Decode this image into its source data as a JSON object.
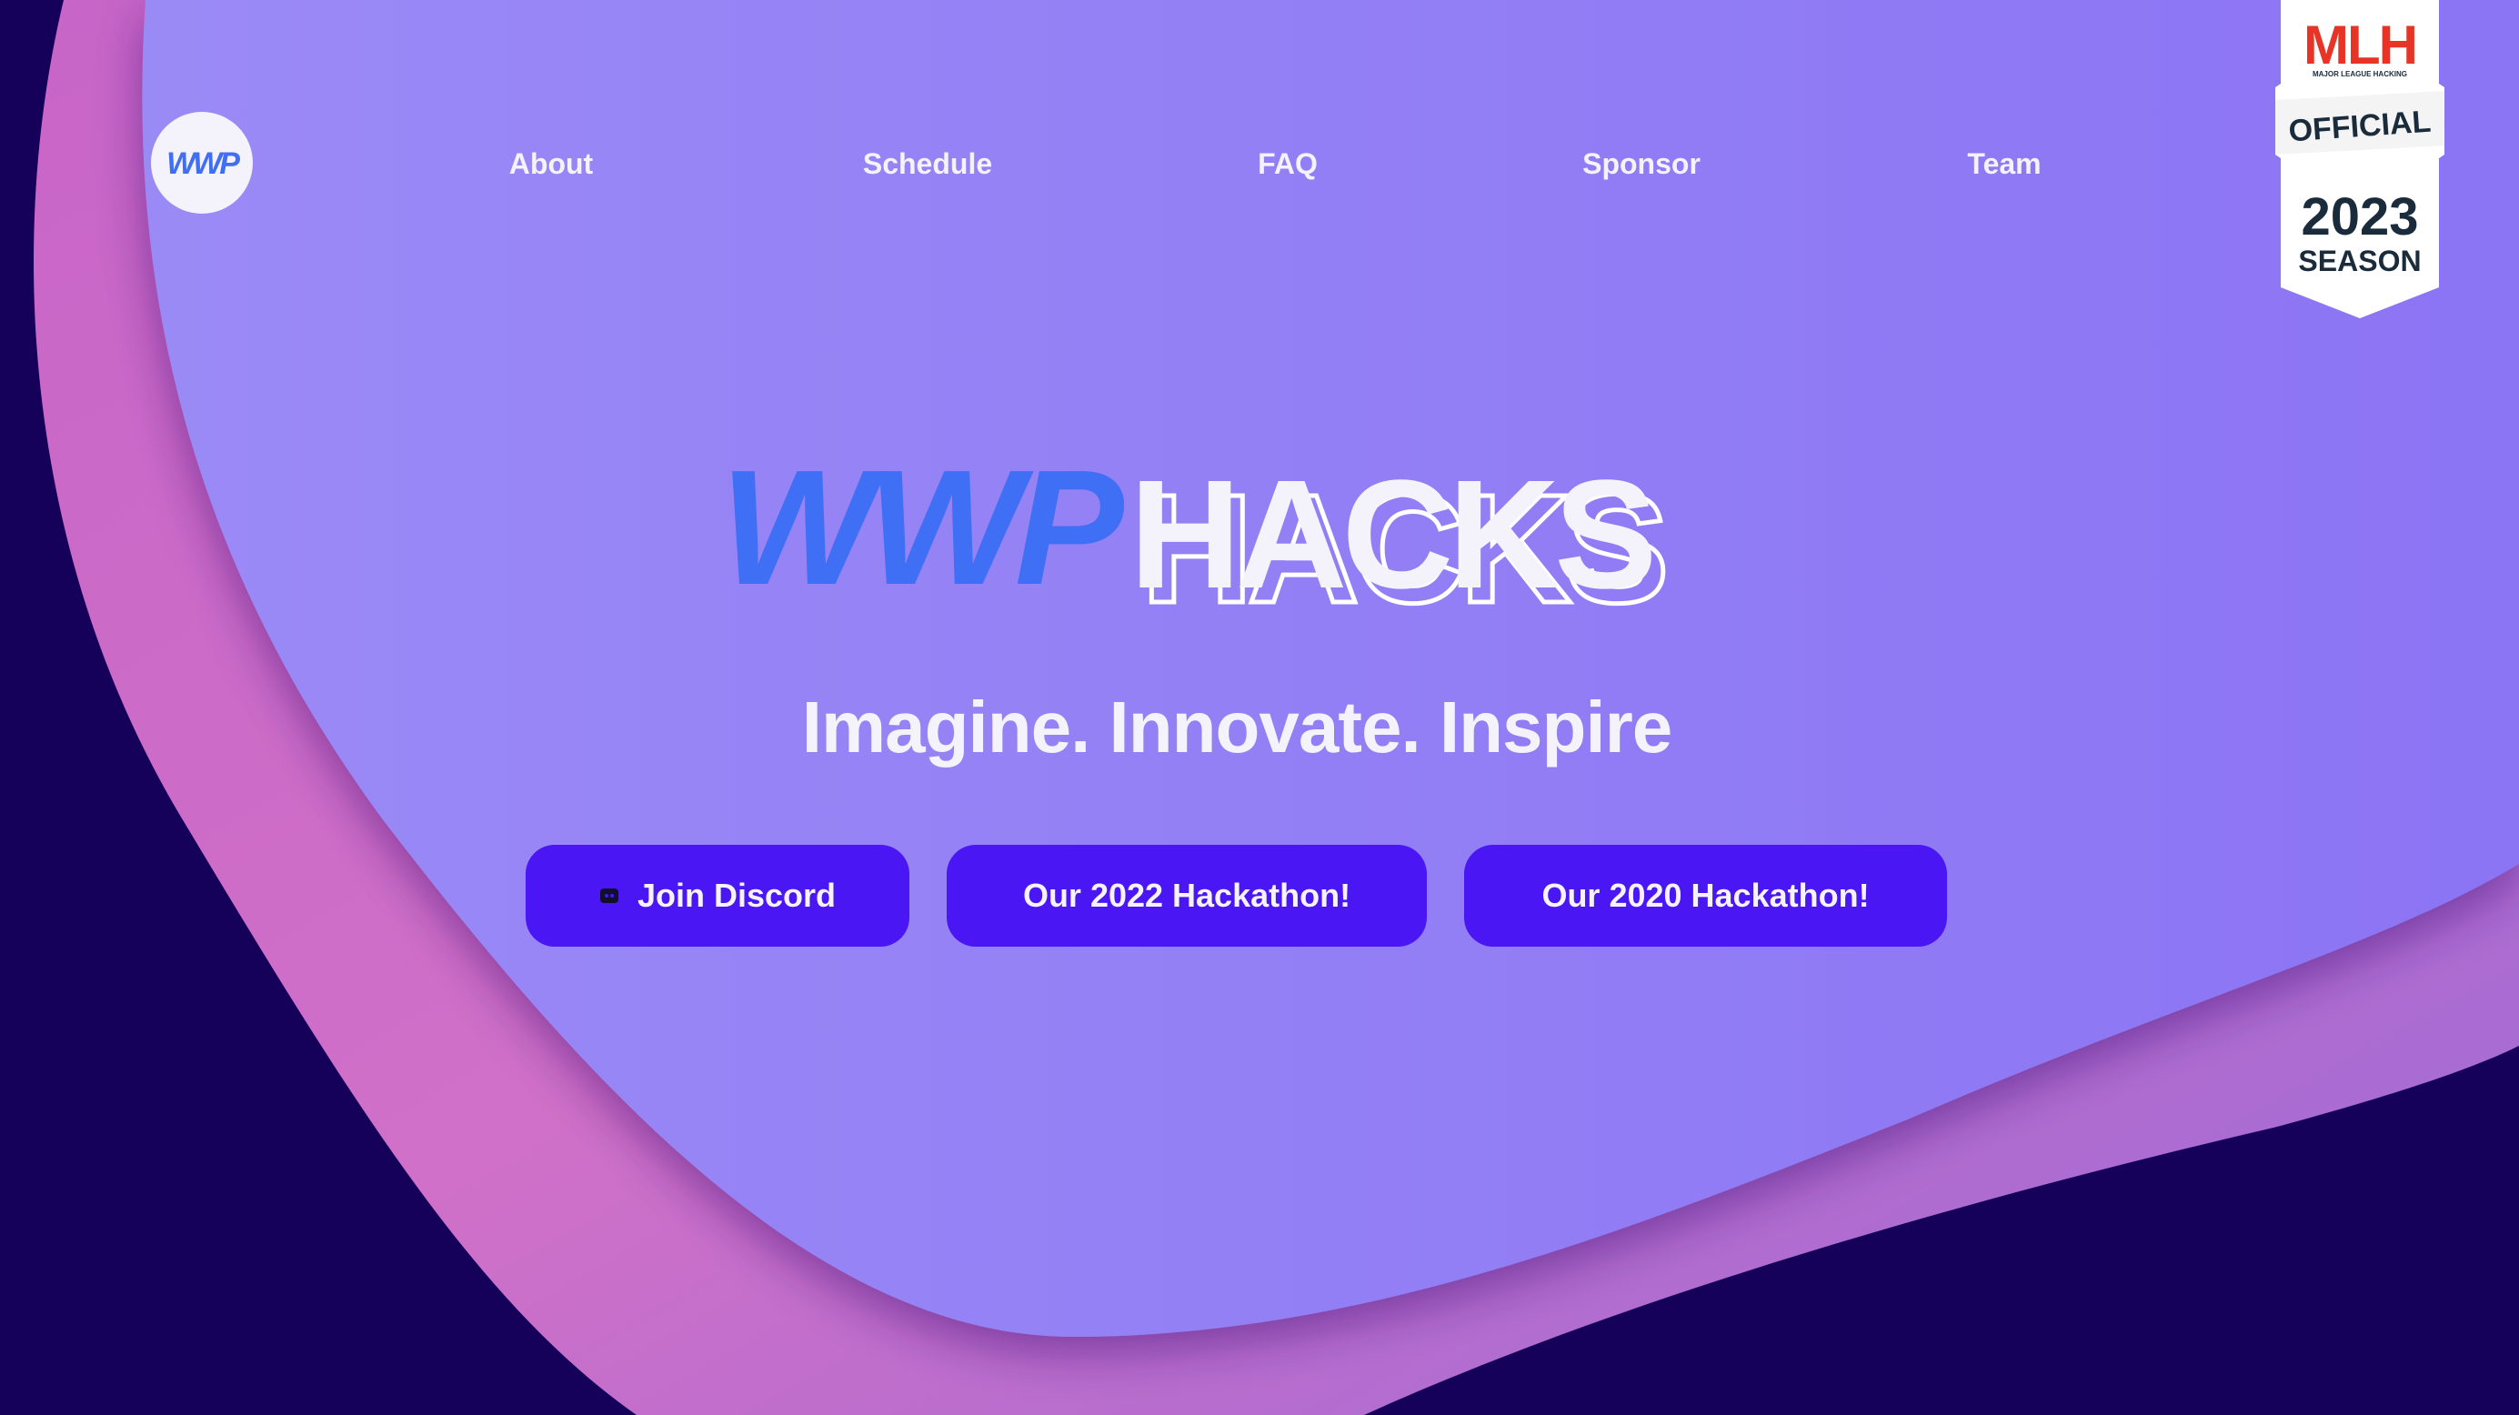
{
  "nav": {
    "logo_text": "WWP",
    "links": [
      "About",
      "Schedule",
      "FAQ",
      "Sponsor",
      "Team"
    ]
  },
  "mlh_badge": {
    "brand": "MLH",
    "subtitle": "MAJOR LEAGUE HACKING",
    "official": "OFFICIAL",
    "year": "2023",
    "season": "SEASON"
  },
  "hero": {
    "logo_part1": "WWP",
    "logo_part2": "HACKS",
    "tagline": "Imagine. Innovate. Inspire"
  },
  "buttons": {
    "discord": "Join Discord",
    "discord_icon": "discord-icon",
    "hackathon_2022": "Our 2022 Hackathon!",
    "hackathon_2020": "Our 2020 Hackathon!"
  },
  "colors": {
    "background": "#16015a",
    "pink_wave": "#d070c8",
    "purple_blob": "#9486f5",
    "button": "#4a16f3",
    "text": "#f4f2fb",
    "logo_blue": "#3f6ff5"
  }
}
